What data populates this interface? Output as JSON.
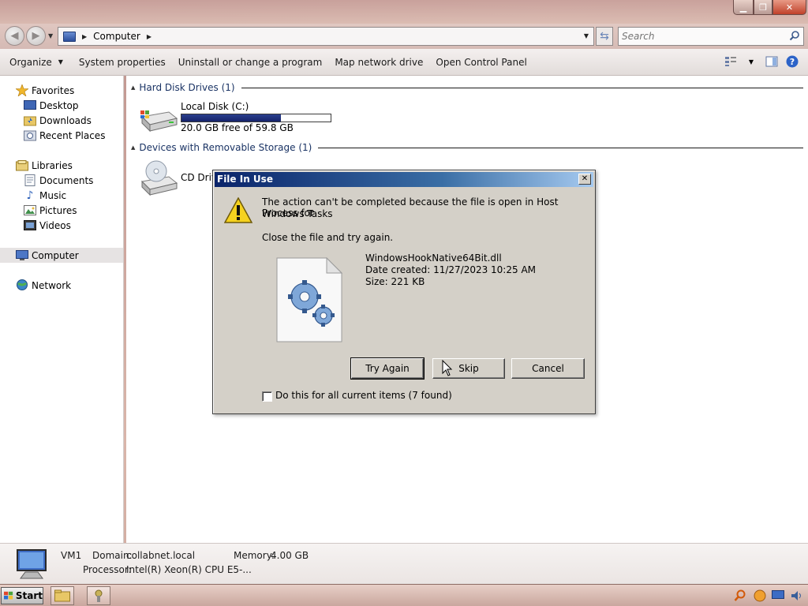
{
  "window": {
    "caption_buttons": {
      "minimize": "▁",
      "maximize": "❐",
      "close": "✕"
    }
  },
  "navbar": {
    "address": {
      "crumbs": [
        "Computer"
      ]
    },
    "search": {
      "placeholder": "Search"
    }
  },
  "toolbar": {
    "organize": "Organize",
    "items": [
      "System properties",
      "Uninstall or change a program",
      "Map network drive",
      "Open Control Panel"
    ]
  },
  "navpane": {
    "favorites": {
      "label": "Favorites",
      "items": [
        "Desktop",
        "Downloads",
        "Recent Places"
      ]
    },
    "libraries": {
      "label": "Libraries",
      "items": [
        "Documents",
        "Music",
        "Pictures",
        "Videos"
      ]
    },
    "computer": "Computer",
    "network": "Network"
  },
  "content": {
    "hard_disk_header": "Hard Disk Drives (1)",
    "removable_header": "Devices with Removable Storage (1)",
    "local_disk": {
      "name": "Local Disk (C:)",
      "free_text": "20.0 GB free of 59.8 GB",
      "used_fraction": 0.665
    },
    "cd_drive": {
      "name": "CD Drive"
    }
  },
  "details": {
    "name": "VM1",
    "domain_label": "Domain:",
    "domain_value": "collabnet.local",
    "memory_label": "Memory:",
    "memory_value": "4.00 GB",
    "processor_label": "Processor:",
    "processor_value": "Intel(R) Xeon(R) CPU E5-..."
  },
  "taskbar": {
    "start": "Start"
  },
  "dialog": {
    "title": "File In Use",
    "close_glyph": "✕",
    "message_line1": "The action can't be completed because the file is open in Host Process for",
    "message_line2": "Windows Tasks",
    "instruction": "Close the file and try again.",
    "file_name": "WindowsHookNative64Bit.dll",
    "date_created": "Date created: 11/27/2023 10:25 AM",
    "size": "Size: 221 KB",
    "buttons": {
      "try_again": "Try Again",
      "skip": "Skip",
      "cancel": "Cancel"
    },
    "checkbox_label": "Do this for all current items (7 found)",
    "checkbox_checked": false
  },
  "colors": {
    "dialog_title_start": "#0a246a",
    "capacity_fill": "#16246a",
    "accent_blue": "#1a3364"
  }
}
